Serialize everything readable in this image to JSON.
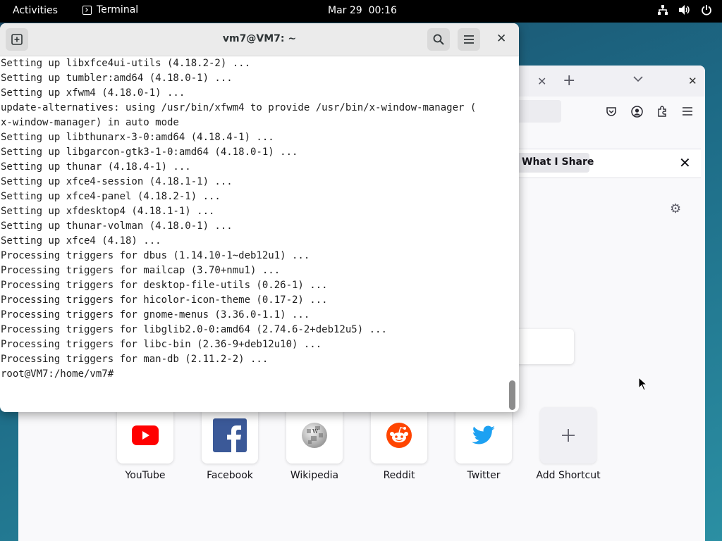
{
  "topbar": {
    "activities": "Activities",
    "app_name": "Terminal",
    "clock": "Mar 29  00:16",
    "icons": [
      "network-icon",
      "volume-icon",
      "power-icon"
    ]
  },
  "terminal": {
    "title": "vm7@VM7: ~",
    "lines": [
      "Setting up libxfce4ui-utils (4.18.2-2) ...",
      "Setting up tumbler:amd64 (4.18.0-1) ...",
      "Setting up xfwm4 (4.18.0-1) ...",
      "update-alternatives: using /usr/bin/xfwm4 to provide /usr/bin/x-window-manager (",
      "x-window-manager) in auto mode",
      "Setting up libthunarx-3-0:amd64 (4.18.4-1) ...",
      "Setting up libgarcon-gtk3-1-0:amd64 (4.18.0-1) ...",
      "Setting up thunar (4.18.4-1) ...",
      "Setting up xfce4-session (4.18.1-1) ...",
      "Setting up xfce4-panel (4.18.2-1) ...",
      "Setting up xfdesktop4 (4.18.1-1) ...",
      "Setting up thunar-volman (4.18.0-1) ...",
      "Setting up xfce4 (4.18) ...",
      "Processing triggers for dbus (1.14.10-1~deb12u1) ...",
      "Processing triggers for mailcap (3.70+nmu1) ...",
      "Processing triggers for desktop-file-utils (0.26-1) ...",
      "Processing triggers for hicolor-icon-theme (0.17-2) ...",
      "Processing triggers for gnome-menus (3.36.0-1.1) ...",
      "Processing triggers for libglib2.0-0:amd64 (2.74.6-2+deb12u5) ...",
      "Processing triggers for libc-bin (2.36-9+deb12u10) ...",
      "Processing triggers for man-db (2.11.2-2) ...",
      "root@VM7:/home/vm7#"
    ]
  },
  "browser": {
    "notice_text": "What I Share",
    "shortcuts": [
      {
        "label": "YouTube",
        "icon": "youtube-icon"
      },
      {
        "label": "Facebook",
        "icon": "facebook-icon"
      },
      {
        "label": "Wikipedia",
        "icon": "wikipedia-icon"
      },
      {
        "label": "Reddit",
        "icon": "reddit-icon"
      },
      {
        "label": "Twitter",
        "icon": "twitter-icon"
      },
      {
        "label": "Add Shortcut",
        "icon": "plus-icon"
      }
    ]
  },
  "colors": {
    "youtube": "#ff0000",
    "facebook": "#3b5998",
    "reddit": "#ff4500",
    "twitter": "#1da1f2"
  }
}
